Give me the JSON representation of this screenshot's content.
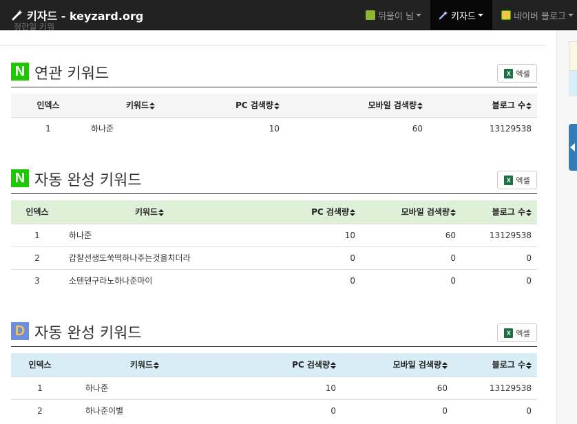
{
  "navbar": {
    "brand": "키자드 - keyzard.org",
    "items": [
      {
        "label": "뒤울이 님",
        "icon": "user-avatar-icon"
      },
      {
        "label": "키자드",
        "icon": "magic-wand-icon"
      },
      {
        "label": "네이버 블로그",
        "icon": "naver-blog-icon"
      }
    ]
  },
  "top_cut_text": "정한일 키워",
  "colors": {
    "naver": "#1ec800",
    "daum": "#6d8ddf",
    "excel": "#1d7044"
  },
  "sections": [
    {
      "badge": "N",
      "title": "연관 키워드",
      "excel_label": "엑셀",
      "headers": [
        "인덱스",
        "키워드",
        "PC 검색량",
        "모바일 검색량",
        "블로그 수"
      ],
      "rows": [
        [
          "1",
          "하나준",
          "10",
          "60",
          "13129538"
        ]
      ]
    },
    {
      "badge": "N",
      "title": "자동 완성 키워드",
      "excel_label": "엑셀",
      "headers": [
        "인덱스",
        "키워드",
        "PC 검색량",
        "모바일 검색량",
        "블로그 수"
      ],
      "rows": [
        [
          "1",
          "하나준",
          "10",
          "60",
          "13129538"
        ],
        [
          "2",
          "감찰선생도쑥떡하나주는것을치더라",
          "0",
          "0",
          "0"
        ],
        [
          "3",
          "소텐덴구라노하나준마이",
          "0",
          "0",
          "0"
        ]
      ]
    },
    {
      "badge": "D",
      "title": "자동 완성 키워드",
      "excel_label": "엑셀",
      "headers": [
        "인덱스",
        "키워드",
        "PC 검색량",
        "모바일 검색량",
        "블로그 수"
      ],
      "rows": [
        [
          "1",
          "하나준",
          "10",
          "60",
          "13129538"
        ],
        [
          "2",
          "하나준이별",
          "0",
          "0",
          "0"
        ]
      ]
    }
  ]
}
